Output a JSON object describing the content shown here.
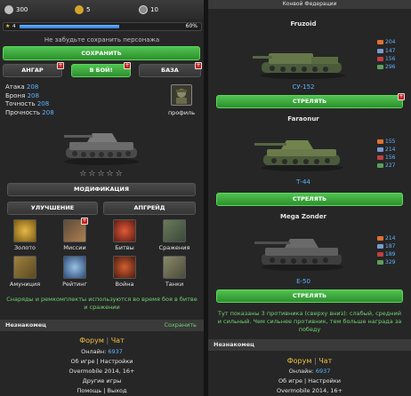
{
  "left": {
    "resources": [
      {
        "icon": "silver-coin-icon",
        "value": "300"
      },
      {
        "icon": "gold-coin-icon",
        "value": "5"
      },
      {
        "icon": "fuel-icon",
        "value": "10"
      }
    ],
    "level": "4",
    "xp_percent_label": "60%",
    "xp_fraction": 0.6,
    "save_hint": "Не забудьте сохранить персонажа",
    "save_button": "СОХРАНИТЬ",
    "nav": {
      "hangar": "АНГАР",
      "battle": "В БОЙ!",
      "base": "БАЗА"
    },
    "stats": [
      {
        "label": "Атака",
        "value": "208"
      },
      {
        "label": "Броня",
        "value": "208"
      },
      {
        "label": "Точность",
        "value": "208"
      },
      {
        "label": "Прочность",
        "value": "208"
      }
    ],
    "profile_label": "профиль",
    "stars": "☆☆☆☆☆",
    "modification_button": "МОДИФИКАЦИЯ",
    "upgrade_button": "УЛУЧШЕНИЕ",
    "upgrade2_button": "АПГРЕЙД",
    "grid": [
      "Золото",
      "Миссии",
      "Битвы",
      "Сражения",
      "Амуниция",
      "Рейтинг",
      "Война",
      "Танки"
    ],
    "info_text": "Снаряды и ремкомплекты используются во время боя в битве и сражении",
    "user_name": "Незнакомец",
    "user_action": "Сохранить",
    "footer": {
      "forum": "Форум",
      "sep": "|",
      "chat": "Чат",
      "online_label": "Онлайн:",
      "online_value": "6937",
      "about": "Об игре | Настройки",
      "copyright": "Overmobile 2014, 16+",
      "other": "Другие игры",
      "help": "Помощь | Выход"
    }
  },
  "right": {
    "header": "Конвой Федерации",
    "enemies": [
      {
        "name": "Fruzoid",
        "model": "СУ-152",
        "stats": [
          "204",
          "147",
          "156",
          "296"
        ],
        "button": "СТРЕЛЯТЬ"
      },
      {
        "name": "Faraonur",
        "model": "Т-44",
        "stats": [
          "155",
          "214",
          "156",
          "227"
        ],
        "button": "СТРЕЛЯТЬ"
      },
      {
        "name": "Mega Zonder",
        "model": "E-50",
        "stats": [
          "214",
          "187",
          "189",
          "329"
        ],
        "button": "СТРЕЛЯТЬ"
      }
    ],
    "info_text": "Тут показаны 3 противника (сверху вниз): слабый, средний и сильный. Чем сильнее противник, тем больше награда за победу",
    "user_name": "Незнакомец",
    "footer": {
      "forum": "Форум",
      "sep": "|",
      "chat": "Чат",
      "online_label": "Онлайн:",
      "online_value": "6937",
      "about": "Об игре | Настройки",
      "copyright": "Overmobile 2014, 16+"
    }
  },
  "colors": {
    "accent_green": "#3aab3a",
    "stat_blue": "#5fb3ff",
    "badge_red": "#c02020",
    "hint_green": "#6fd36f"
  }
}
